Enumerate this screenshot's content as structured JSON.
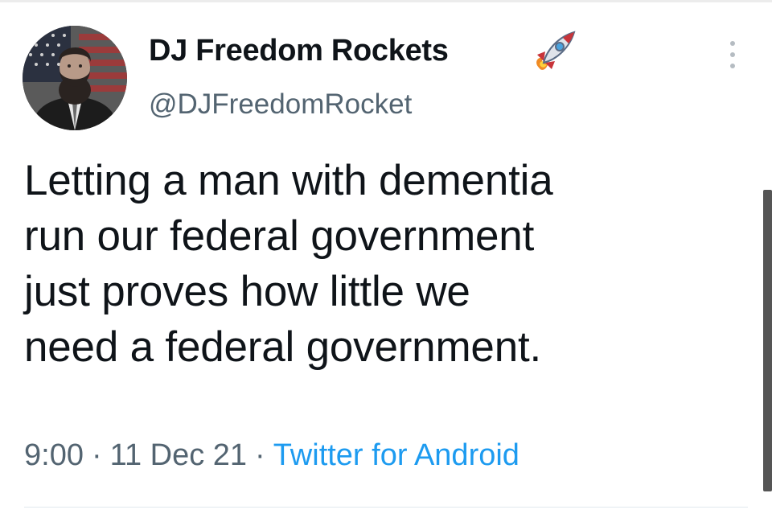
{
  "tweet": {
    "author": {
      "display_name": "DJ Freedom Rockets",
      "handle": "@DJFreedomRocket",
      "name_emoji_icon": "rocket-icon",
      "avatar_icon": "profile-photo-avatar"
    },
    "text_lines": [
      "Letting a man with dementia",
      "run our federal government",
      "just proves how little we",
      "need a federal government."
    ],
    "time": "9:00",
    "separator": "·",
    "date": "11 Dec 21",
    "source": "Twitter for Android",
    "more_icon": "more-vertical-icon"
  },
  "colors": {
    "text_primary": "#0f1419",
    "text_secondary": "#536471",
    "link": "#1d9bf0",
    "background": "#ffffff",
    "scrollbar": "#555555"
  }
}
